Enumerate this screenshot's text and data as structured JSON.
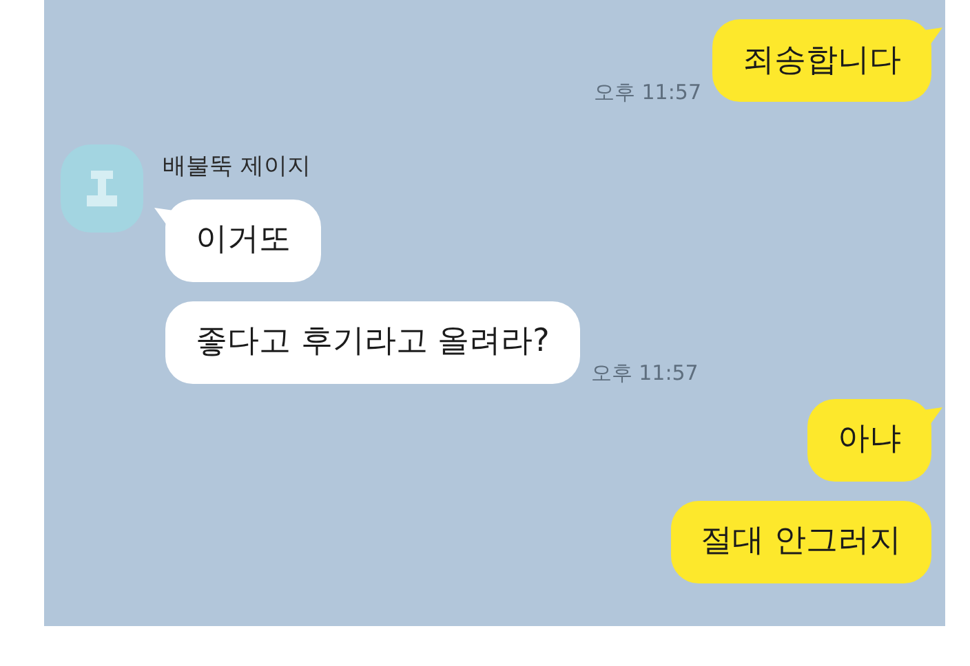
{
  "messages": [
    {
      "kind": "sent",
      "bubbles": [
        {
          "text": "죄송합니다",
          "tail": true
        }
      ],
      "time": "오후 11:57"
    },
    {
      "kind": "received",
      "sender": "배불뚝 제이지",
      "bubbles": [
        {
          "text": "이거또",
          "tail": true
        },
        {
          "text": "좋다고 후기라고 올려라?",
          "tail": false
        }
      ],
      "time": "오후 11:57"
    },
    {
      "kind": "sent",
      "bubbles": [
        {
          "text": "아냐",
          "tail": true
        },
        {
          "text": "절대 안그러지",
          "tail": false
        }
      ]
    }
  ]
}
